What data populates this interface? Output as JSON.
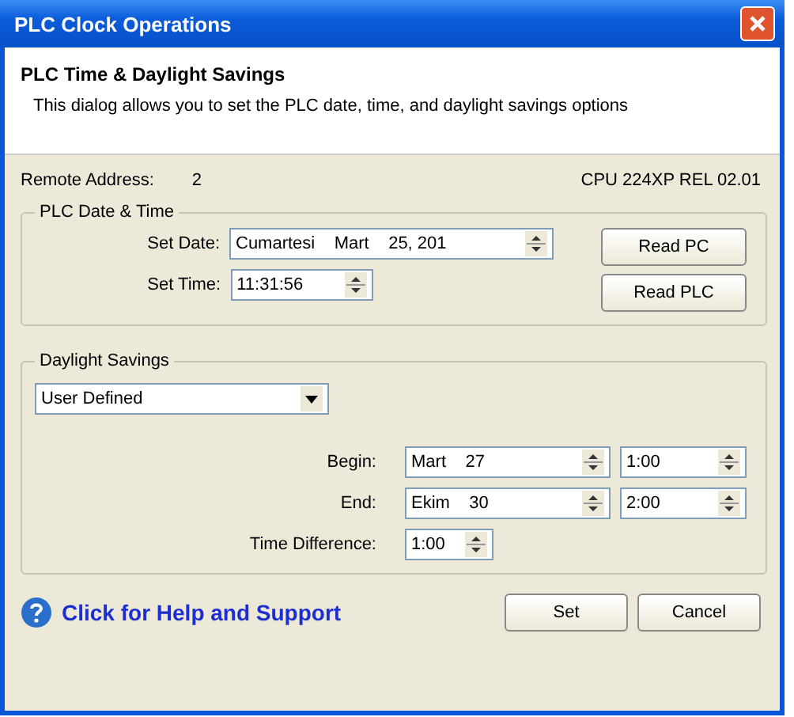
{
  "window": {
    "title": "PLC Clock Operations"
  },
  "header": {
    "title": "PLC Time & Daylight Savings",
    "description": "This dialog allows you to set the PLC date, time, and daylight savings options"
  },
  "info": {
    "remote_address_label": "Remote Address:",
    "remote_address": "2",
    "cpu": "CPU 224XP REL 02.01"
  },
  "date_time": {
    "title": "PLC Date & Time",
    "fields": [
      {
        "label": "Set Date:",
        "value": "Cumartesi    Mart    25, 201",
        "kind": "wide"
      },
      {
        "label": "Set Time:",
        "value": "11:31:56",
        "kind": "narrow"
      }
    ],
    "buttons": [
      "Read PC",
      "Read PLC"
    ]
  },
  "daylight": {
    "title": "Daylight Savings",
    "mode": "User Defined",
    "rows": [
      {
        "label": "Begin:",
        "date": "Mart    27",
        "time": "1:00"
      },
      {
        "label": "End:",
        "date": "Ekim    30",
        "time": "2:00"
      }
    ],
    "difference_label": "Time Difference:",
    "difference": "1:00"
  },
  "help_link": "Click for Help and Support",
  "buttons": [
    "Set",
    "Cancel"
  ]
}
